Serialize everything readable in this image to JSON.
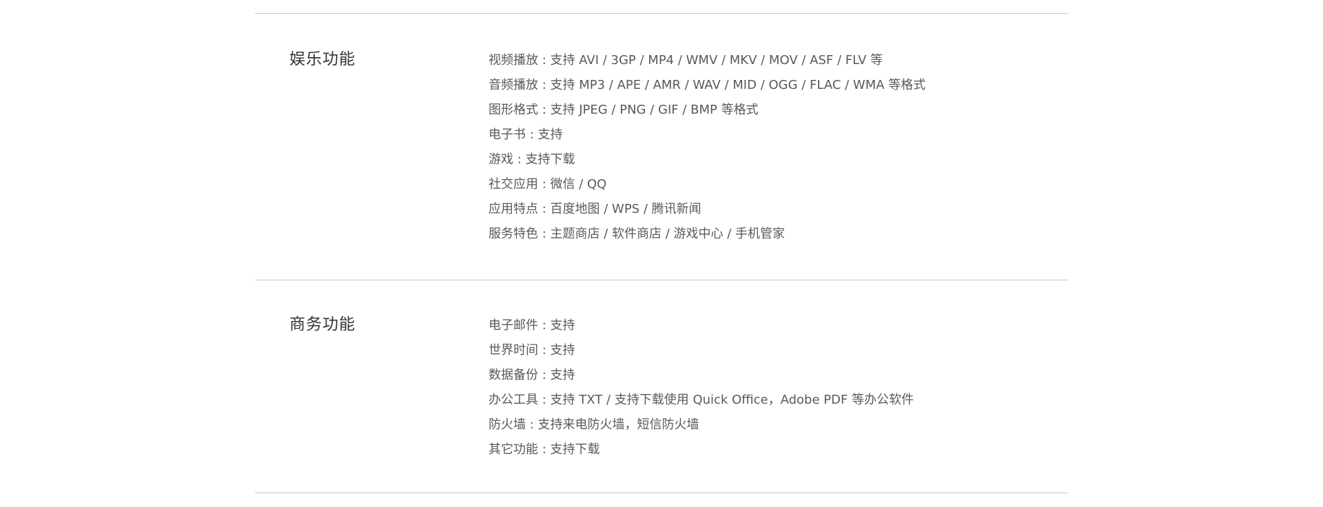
{
  "sections": [
    {
      "title": "娱乐功能",
      "items": [
        "视频播放 : 支持 AVI / 3GP / MP4 / WMV / MKV / MOV / ASF / FLV 等",
        "音频播放 : 支持 MP3 / APE / AMR / WAV / MID / OGG / FLAC / WMA 等格式",
        "图形格式 : 支持 JPEG / PNG / GIF / BMP 等格式",
        "电子书 : 支持",
        "游戏 : 支持下载",
        "社交应用 : 微信 / QQ",
        "应用特点 : 百度地图 / WPS / 腾讯新闻",
        "服务特色 : 主题商店 / 软件商店 / 游戏中心 / 手机管家"
      ]
    },
    {
      "title": "商务功能",
      "items": [
        "电子邮件 : 支持",
        "世界时间 : 支持",
        "数据备份 : 支持",
        "办公工具 : 支持 TXT / 支持下载使用 Quick Office，Adobe PDF 等办公软件",
        "防火墙 : 支持来电防火墙，短信防火墙",
        "其它功能 : 支持下载"
      ]
    }
  ]
}
